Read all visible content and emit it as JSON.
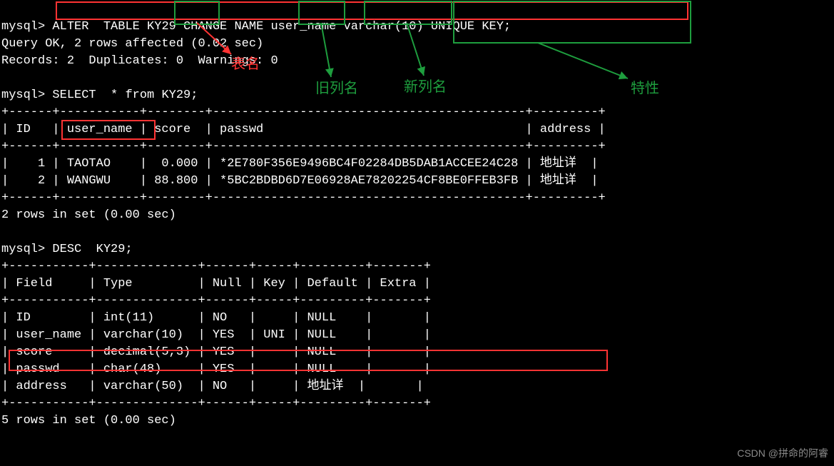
{
  "cmd1": {
    "prompt": "mysql>",
    "sql": "ALTER  TABLE KY29 CHANGE NAME user_name varchar(10) UNIQUE KEY;",
    "result1": "Query OK, 2 rows affected (0.02 sec)",
    "result2": "Records: 2  Duplicates: 0  Warnings: 0"
  },
  "cmd2": {
    "prompt": "mysql>",
    "sql": "SELECT  * from KY29;",
    "border": "+------+-----------+--------+-------------------------------------------+---------+",
    "headers": "| ID   | user_name | score  | passwd                                    | address |",
    "rows": [
      "|    1 | TAOTAO    |  0.000 | *2E780F356E9496BC4F02284DB5DAB1ACCEE24C28 | 地址详  |",
      "|    2 | WANGWU    | 88.800 | *5BC2BDBD6D7E06928AE78202254CF8BE0FFEB3FB | 地址详  |"
    ],
    "footer": "2 rows in set (0.00 sec)"
  },
  "cmd3": {
    "prompt": "mysql>",
    "sql": "DESC  KY29;",
    "border": "+-----------+--------------+------+-----+---------+-------+",
    "headers": "| Field     | Type         | Null | Key | Default | Extra |",
    "rows": [
      "| ID        | int(11)      | NO   |     | NULL    |       |",
      "| user_name | varchar(10)  | YES  | UNI | NULL    |       |",
      "| score     | decimal(5,3) | YES  |     | NULL    |       |",
      "| passwd    | char(48)     | YES  |     | NULL    |       |",
      "| address   | varchar(50)  | NO   |     | 地址详  |       |"
    ],
    "footer": "5 rows in set (0.00 sec)"
  },
  "annotations": {
    "table_name": "表名",
    "old_col": "旧列名",
    "new_col": "新列名",
    "feature": "特性"
  },
  "watermark": "CSDN @拼命的阿睿"
}
